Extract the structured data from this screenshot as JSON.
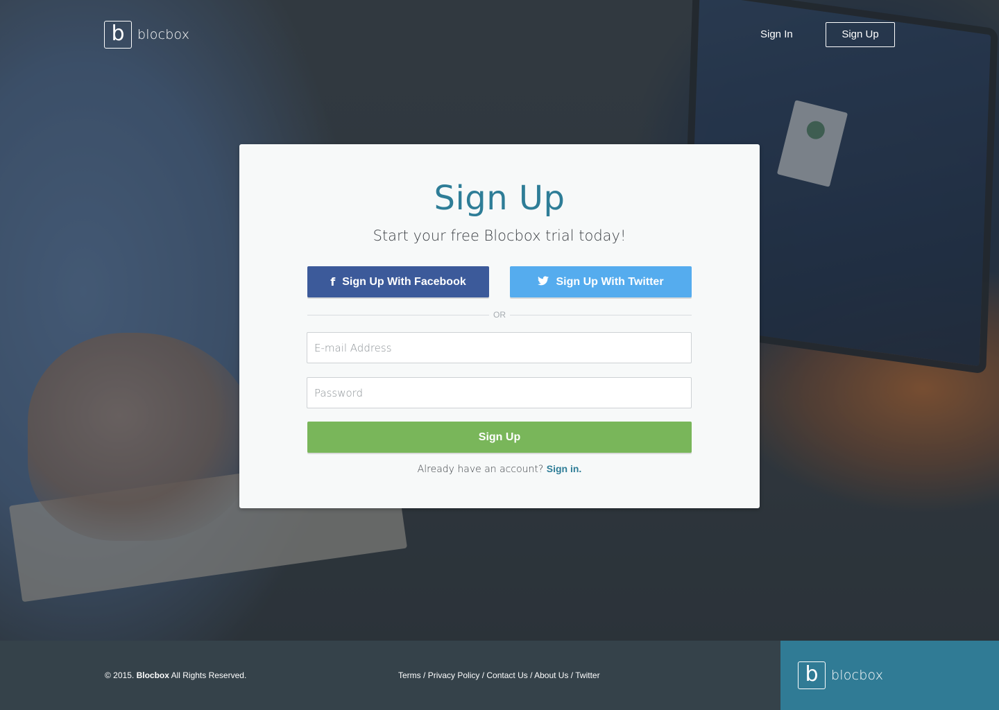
{
  "brand": {
    "name": "blocbox",
    "mark": "b"
  },
  "header": {
    "sign_in_label": "Sign In",
    "sign_up_label": "Sign Up"
  },
  "card": {
    "title": "Sign Up",
    "subtitle": "Start your free Blocbox trial today!",
    "facebook_label": "Sign Up With Facebook",
    "twitter_label": "Sign Up With Twitter",
    "facebook_icon": "facebook-icon",
    "twitter_icon": "twitter-icon",
    "divider_text": "OR",
    "email_placeholder": "E-mail Address",
    "password_placeholder": "Password",
    "submit_label": "Sign Up",
    "already_text": "Already have an account?",
    "sign_in_link": "Sign in."
  },
  "footer": {
    "copyright_prefix": "© 2015.",
    "copyright_brand": "Blocbox",
    "copyright_suffix": "All Rights Reserved.",
    "links": [
      "Terms",
      "Privacy Policy",
      "Contact Us",
      "About Us",
      "Twitter"
    ],
    "separator": " / "
  },
  "colors": {
    "accent": "#2e7d97",
    "facebook": "#3c5a9a",
    "twitter": "#55acee",
    "submit": "#79b65a",
    "footer": "#35424a",
    "footer_brand": "#307b95",
    "card": "#f7f9f9"
  }
}
